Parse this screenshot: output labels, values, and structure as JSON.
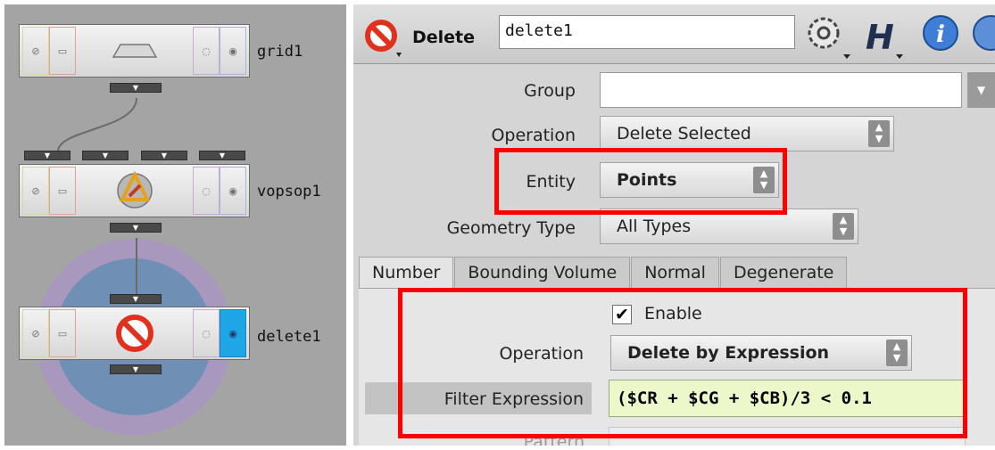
{
  "network": {
    "nodes": [
      {
        "name": "grid1"
      },
      {
        "name": "vopsop1"
      },
      {
        "name": "delete1"
      }
    ],
    "port_glyph": "▼"
  },
  "params": {
    "op_type_label": "Delete",
    "op_name": "delete1",
    "group_label": "Group",
    "group_value": "",
    "operation_label": "Operation",
    "operation_value": "Delete Selected",
    "entity_label": "Entity",
    "entity_value": "Points",
    "geometry_type_label": "Geometry Type",
    "geometry_type_value": "All Types",
    "tabs": [
      {
        "label": "Number",
        "active": true
      },
      {
        "label": "Bounding Volume",
        "active": false
      },
      {
        "label": "Normal",
        "active": false
      },
      {
        "label": "Degenerate",
        "active": false
      }
    ],
    "number_tab": {
      "enable_label": "Enable",
      "enable_checked": true,
      "operation_label": "Operation",
      "operation_value": "Delete by Expression",
      "filter_expression_label": "Filter Expression",
      "filter_expression_value": "($CR + $CG + $CB)/3 < 0.1",
      "pattern_label": "Pattern"
    }
  },
  "menu_arrow_glyph": "▲\n▼",
  "checkmark_glyph": "✔",
  "colors": {
    "highlight": "#ff0000",
    "display_flag": "#1fa6e6",
    "expression_bg": "#ecf8c9"
  },
  "icons": [
    "gear-icon",
    "houdini-help-icon",
    "info-icon",
    "delete-icon"
  ]
}
